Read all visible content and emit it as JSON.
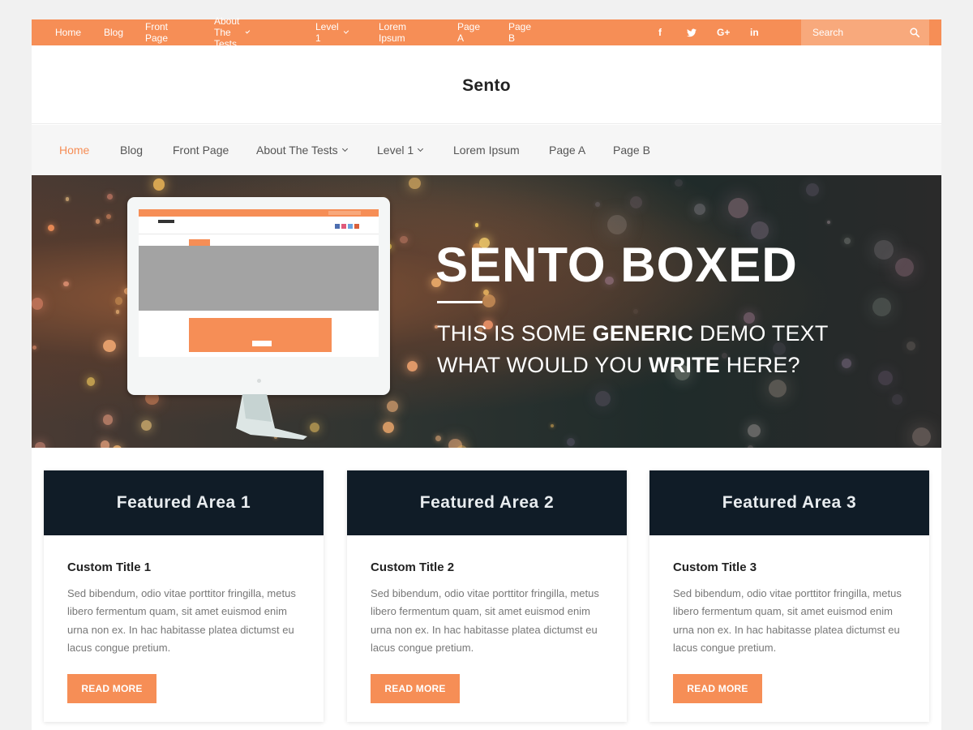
{
  "topbar": {
    "nav": [
      {
        "label": "Home",
        "dropdown": false
      },
      {
        "label": "Blog",
        "dropdown": false
      },
      {
        "label": "Front Page",
        "dropdown": false
      },
      {
        "label": "About The Tests",
        "dropdown": true
      },
      {
        "label": "Level 1",
        "dropdown": true
      },
      {
        "label": "Lorem Ipsum",
        "dropdown": false
      },
      {
        "label": "Page A",
        "dropdown": false
      },
      {
        "label": "Page B",
        "dropdown": false
      }
    ],
    "social": [
      "f",
      "twitter-icon",
      "G+",
      "in"
    ],
    "social_text": {
      "facebook": "f",
      "googleplus": "G+",
      "linkedin": "in"
    },
    "search_placeholder": "Search"
  },
  "header": {
    "site_title": "Sento"
  },
  "mainnav": {
    "items": [
      {
        "label": "Home",
        "active": true
      },
      {
        "label": "Blog"
      },
      {
        "label": "Front Page"
      },
      {
        "label": "About The Tests",
        "dropdown": true
      },
      {
        "label": "Level 1",
        "dropdown": true
      },
      {
        "label": "Lorem Ipsum"
      },
      {
        "label": "Page A"
      },
      {
        "label": "Page B"
      }
    ]
  },
  "hero": {
    "title": "SENTO BOXED",
    "line1_pre": "THIS IS SOME ",
    "line1_bold": "GENERIC",
    "line1_post": " DEMO TEXT",
    "line2_pre": "WHAT WOULD YOU ",
    "line2_bold": "WRITE",
    "line2_post": " HERE?"
  },
  "featured": [
    {
      "banner": "Featured Area 1",
      "title": "Custom Title 1",
      "text": "Sed bibendum, odio vitae porttitor fringilla, metus libero fermentum quam, sit amet euismod enim urna non ex. In hac habitasse platea dictumst eu lacus congue pretium.",
      "button": "READ MORE"
    },
    {
      "banner": "Featured Area 2",
      "title": "Custom Title 2",
      "text": "Sed bibendum, odio vitae porttitor fringilla, metus libero fermentum quam, sit amet euismod enim urna non ex. In hac habitasse platea dictumst eu lacus congue pretium.",
      "button": "READ MORE"
    },
    {
      "banner": "Featured Area 3",
      "title": "Custom Title 3",
      "text": "Sed bibendum, odio vitae porttitor fringilla, metus libero fermentum quam, sit amet euismod enim urna non ex. In hac habitasse platea dictumst eu lacus congue pretium.",
      "button": "READ MORE"
    }
  ],
  "colors": {
    "accent": "#f68e56",
    "banner": "#101c27"
  }
}
